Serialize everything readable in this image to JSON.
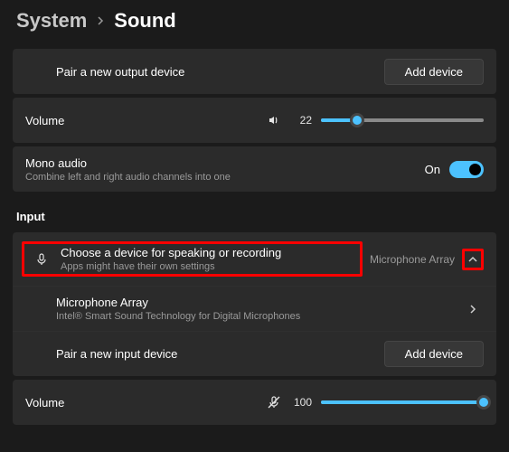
{
  "breadcrumb": {
    "parent": "System",
    "current": "Sound"
  },
  "output": {
    "pair_label": "Pair a new output device",
    "add_button": "Add device",
    "volume_label": "Volume",
    "volume_value": "22",
    "volume_pct": 22,
    "mono_title": "Mono audio",
    "mono_subtitle": "Combine left and right audio channels into one",
    "mono_state": "On"
  },
  "input": {
    "section": "Input",
    "choose_title": "Choose a device for speaking or recording",
    "choose_subtitle": "Apps might have their own settings",
    "selected_device": "Microphone Array",
    "device_title": "Microphone Array",
    "device_subtitle": "Intel® Smart Sound Technology for Digital Microphones",
    "pair_label": "Pair a new input device",
    "add_button": "Add device",
    "volume_label": "Volume",
    "volume_value": "100",
    "volume_pct": 100
  }
}
